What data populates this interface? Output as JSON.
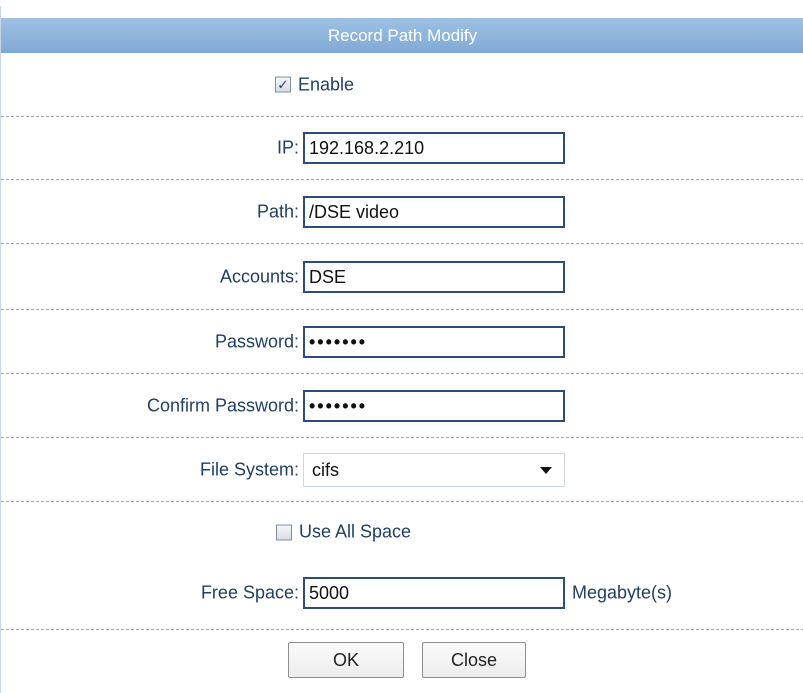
{
  "dialog": {
    "title": "Record Path Modify"
  },
  "form": {
    "enable": {
      "label": "Enable",
      "checked": true
    },
    "ip": {
      "label": "IP:",
      "value": "192.168.2.210"
    },
    "path": {
      "label": "Path:",
      "value": "/DSE video"
    },
    "accounts": {
      "label": "Accounts:",
      "value": "DSE"
    },
    "password": {
      "label": "Password:",
      "value": "•••••••"
    },
    "confirm_password": {
      "label": "Confirm Password:",
      "value": "•••••••"
    },
    "file_system": {
      "label": "File System:",
      "selected": "cifs"
    },
    "use_all_space": {
      "label": "Use All Space",
      "checked": false
    },
    "free_space": {
      "label": "Free Space:",
      "value": "5000",
      "unit": "Megabyte(s)"
    }
  },
  "buttons": {
    "ok": "OK",
    "close": "Close"
  },
  "icons": {
    "checked_checkbox": "checked-checkbox-icon",
    "unchecked_checkbox": "unchecked-checkbox-icon",
    "dropdown": "chevron-down-icon"
  },
  "colors": {
    "title_bar": "#8db3dc",
    "label_text": "#203f63",
    "input_border": "#2f4c76"
  }
}
